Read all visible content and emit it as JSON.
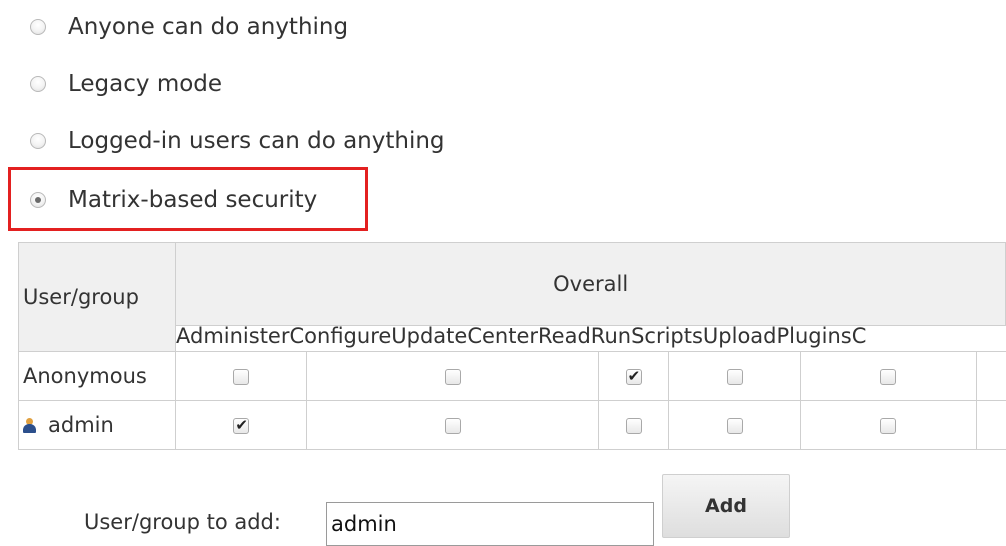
{
  "authorization": {
    "options": [
      {
        "label": "Anyone can do anything",
        "checked": false
      },
      {
        "label": "Legacy mode",
        "checked": false
      },
      {
        "label": "Logged-in users can do anything",
        "checked": false
      },
      {
        "label": "Matrix-based security",
        "checked": true
      }
    ],
    "highlight_color": "#e32020"
  },
  "matrix": {
    "user_group_header": "User/group",
    "group_header": "Overall",
    "permissions": [
      "Administer",
      "ConfigureUpdateCenter",
      "Read",
      "RunScripts",
      "UploadPlugins"
    ],
    "permission_overflow": "C",
    "rows": [
      {
        "name": "Anonymous",
        "icon": null,
        "checks": [
          false,
          false,
          true,
          false,
          false
        ]
      },
      {
        "name": "admin",
        "icon": "user-icon",
        "checks": [
          true,
          false,
          false,
          false,
          false
        ]
      }
    ]
  },
  "add_user": {
    "label": "User/group to add:",
    "input_value": "admin",
    "button_label": "Add"
  }
}
